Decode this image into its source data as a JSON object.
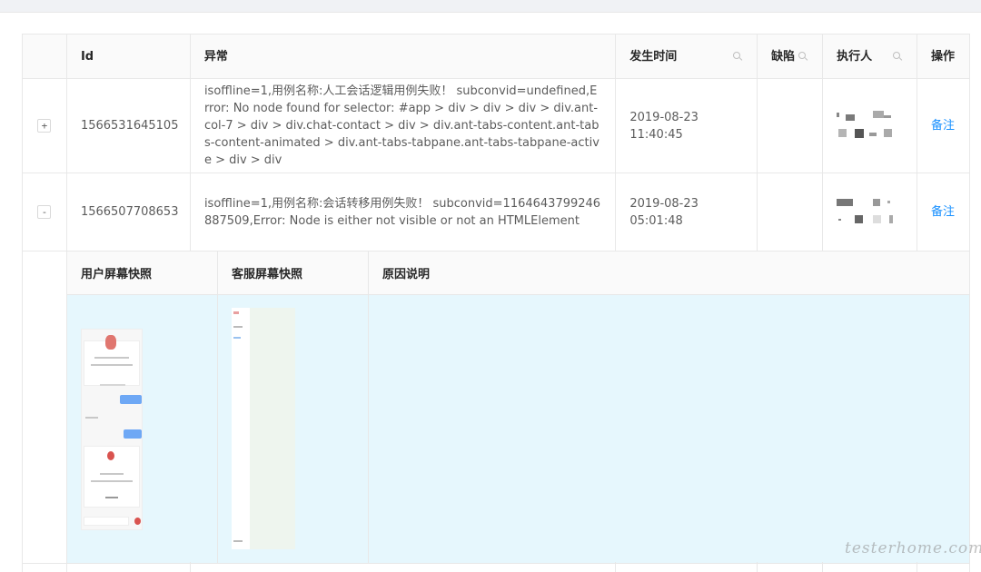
{
  "columns": {
    "id": "Id",
    "exception": "异常",
    "time": "发生时间",
    "defect": "缺陷",
    "executor": "执行人",
    "action": "操作"
  },
  "rows": [
    {
      "expander": "+",
      "id": "1566531645105",
      "exception": "isoffline=1,用例名称:人工会话逻辑用例失败！ subconvid=undefined,Error: No node found for selector: #app > div > div > div > div.ant-col-7 > div > div.chat-contact > div > div.ant-tabs-content.ant-tabs-content-animated > div.ant-tabs-tabpane.ant-tabs-tabpane-active > div > div",
      "time_date": "2019-08-23",
      "time_clock": "11:40:45",
      "defect": "",
      "action": "备注"
    },
    {
      "expander": "-",
      "id": "1566507708653",
      "exception": "isoffline=1,用例名称:会话转移用例失败！ subconvid=1164643799246887509,Error: Node is either not visible or not an HTMLElement",
      "time_date": "2019-08-23",
      "time_clock": "05:01:48",
      "defect": "",
      "action": "备注"
    }
  ],
  "expanded": {
    "columns": {
      "user_snapshot": "用户屏幕快照",
      "agent_snapshot": "客服屏幕快照",
      "reason": "原因说明"
    }
  },
  "watermark": "testerhome.com",
  "colors": {
    "link": "#1890ff",
    "header_bg": "#fafafa",
    "expanded_bg": "#e6f7fd",
    "border": "#e8e8e8"
  }
}
